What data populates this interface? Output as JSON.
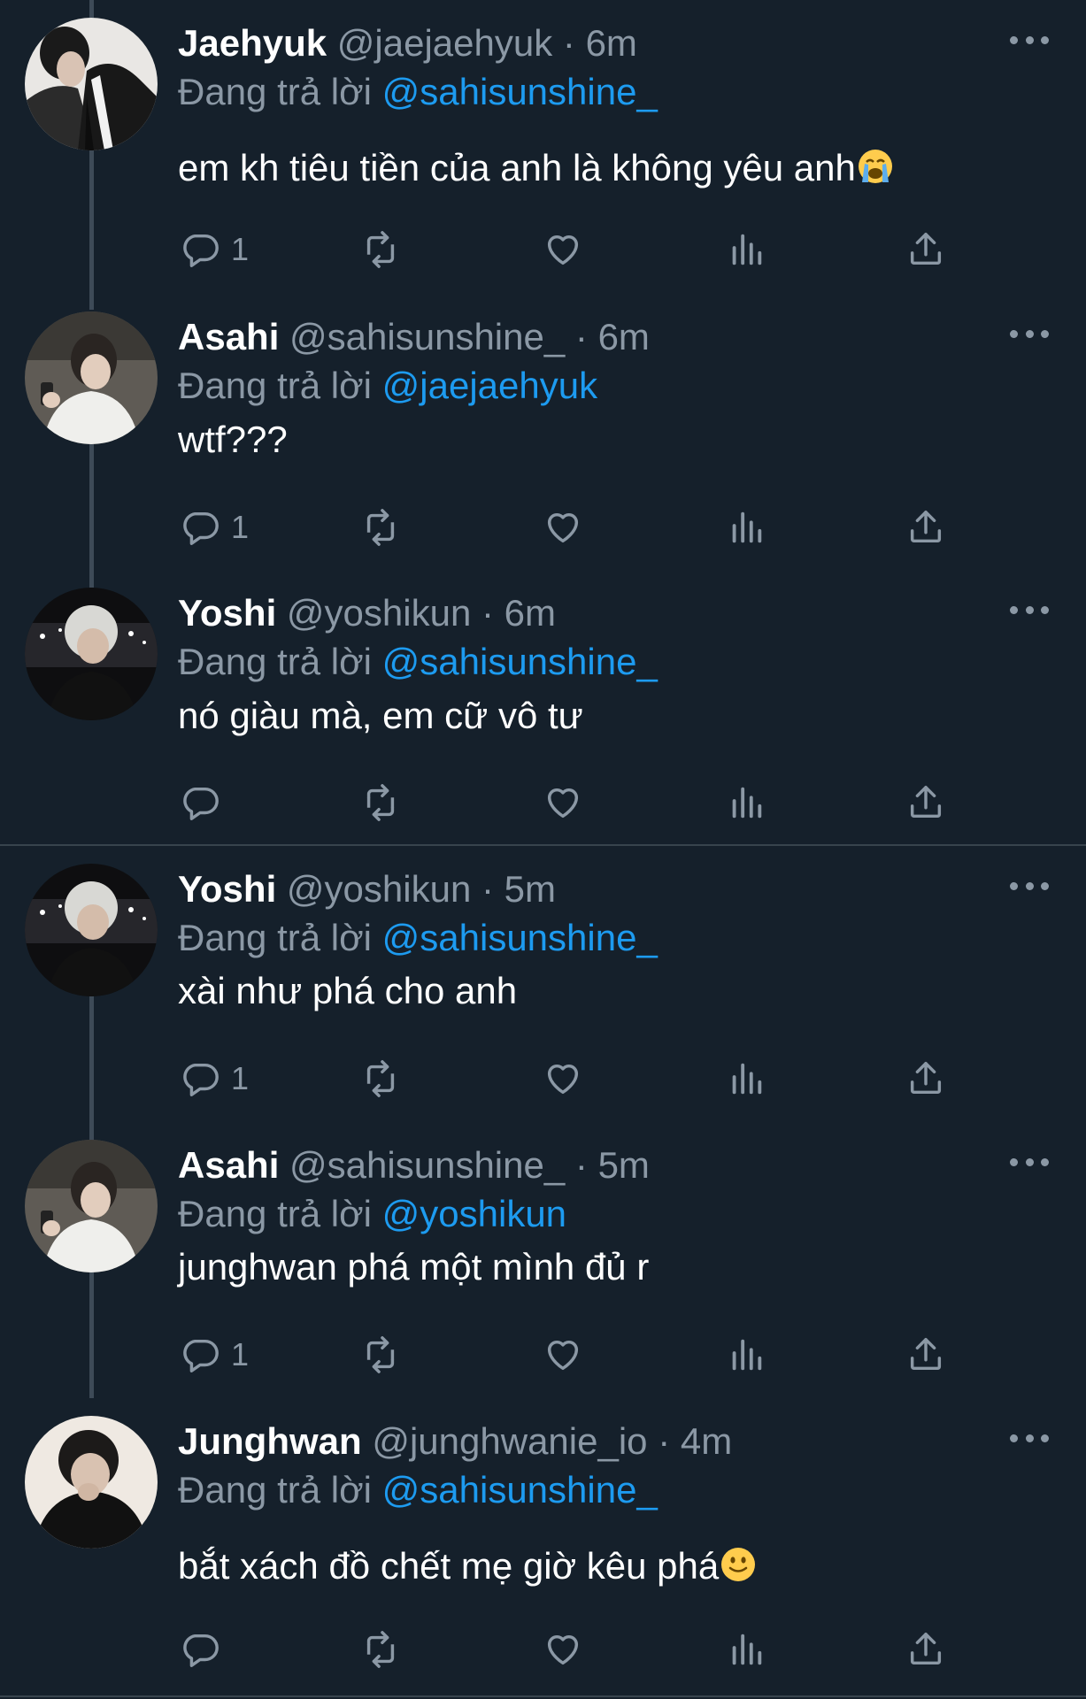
{
  "reply_prefix": "Đang trả lời",
  "tweets": [
    {
      "name": "Jaehyuk",
      "handle": "@jaejaehyuk",
      "sep": "·",
      "time": "6m",
      "reply_to": "@sahisunshine_",
      "text": "em kh tiêu tiền của anh là không yêu anh",
      "emoji": "loudly-crying-face",
      "reply_count": "1"
    },
    {
      "name": "Asahi",
      "handle": "@sahisunshine_",
      "sep": "·",
      "time": "6m",
      "reply_to": "@jaejaehyuk",
      "text": "wtf???",
      "reply_count": "1"
    },
    {
      "name": "Yoshi",
      "handle": "@yoshikun",
      "sep": "·",
      "time": "6m",
      "reply_to": "@sahisunshine_",
      "text": "nó giàu mà, em cữ vô tư",
      "reply_count": ""
    },
    {
      "name": "Yoshi",
      "handle": "@yoshikun",
      "sep": "·",
      "time": "5m",
      "reply_to": "@sahisunshine_",
      "text": "xài như phá cho anh",
      "reply_count": "1"
    },
    {
      "name": "Asahi",
      "handle": "@sahisunshine_",
      "sep": "·",
      "time": "5m",
      "reply_to": "@yoshikun",
      "text": "junghwan phá một mình đủ r",
      "reply_count": "1"
    },
    {
      "name": "Junghwan",
      "handle": "@junghwanie_io",
      "sep": "·",
      "time": "4m",
      "reply_to": "@sahisunshine_",
      "text": "bắt xách đồ chết mẹ giờ kêu phá",
      "emoji": "slightly-smiling-face",
      "reply_count": ""
    }
  ],
  "colors": {
    "background": "#15202b",
    "text_primary": "#ffffff",
    "text_secondary": "#8b98a5",
    "mention": "#1d9bf0",
    "divider": "#38444d"
  }
}
